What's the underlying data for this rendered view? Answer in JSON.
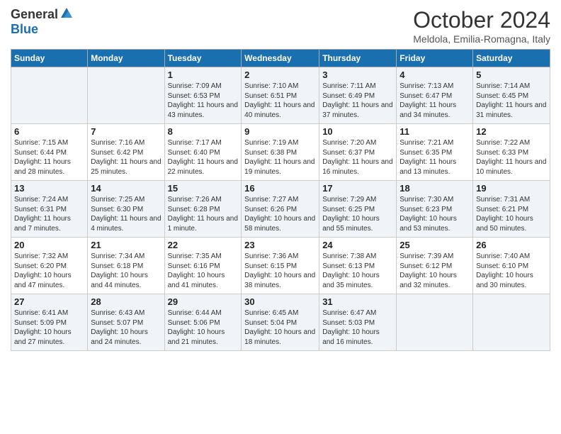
{
  "logo": {
    "general": "General",
    "blue": "Blue"
  },
  "title": "October 2024",
  "location": "Meldola, Emilia-Romagna, Italy",
  "days_of_week": [
    "Sunday",
    "Monday",
    "Tuesday",
    "Wednesday",
    "Thursday",
    "Friday",
    "Saturday"
  ],
  "weeks": [
    [
      {
        "day": "",
        "info": ""
      },
      {
        "day": "",
        "info": ""
      },
      {
        "day": "1",
        "info": "Sunrise: 7:09 AM\nSunset: 6:53 PM\nDaylight: 11 hours and 43 minutes."
      },
      {
        "day": "2",
        "info": "Sunrise: 7:10 AM\nSunset: 6:51 PM\nDaylight: 11 hours and 40 minutes."
      },
      {
        "day": "3",
        "info": "Sunrise: 7:11 AM\nSunset: 6:49 PM\nDaylight: 11 hours and 37 minutes."
      },
      {
        "day": "4",
        "info": "Sunrise: 7:13 AM\nSunset: 6:47 PM\nDaylight: 11 hours and 34 minutes."
      },
      {
        "day": "5",
        "info": "Sunrise: 7:14 AM\nSunset: 6:45 PM\nDaylight: 11 hours and 31 minutes."
      }
    ],
    [
      {
        "day": "6",
        "info": "Sunrise: 7:15 AM\nSunset: 6:44 PM\nDaylight: 11 hours and 28 minutes."
      },
      {
        "day": "7",
        "info": "Sunrise: 7:16 AM\nSunset: 6:42 PM\nDaylight: 11 hours and 25 minutes."
      },
      {
        "day": "8",
        "info": "Sunrise: 7:17 AM\nSunset: 6:40 PM\nDaylight: 11 hours and 22 minutes."
      },
      {
        "day": "9",
        "info": "Sunrise: 7:19 AM\nSunset: 6:38 PM\nDaylight: 11 hours and 19 minutes."
      },
      {
        "day": "10",
        "info": "Sunrise: 7:20 AM\nSunset: 6:37 PM\nDaylight: 11 hours and 16 minutes."
      },
      {
        "day": "11",
        "info": "Sunrise: 7:21 AM\nSunset: 6:35 PM\nDaylight: 11 hours and 13 minutes."
      },
      {
        "day": "12",
        "info": "Sunrise: 7:22 AM\nSunset: 6:33 PM\nDaylight: 11 hours and 10 minutes."
      }
    ],
    [
      {
        "day": "13",
        "info": "Sunrise: 7:24 AM\nSunset: 6:31 PM\nDaylight: 11 hours and 7 minutes."
      },
      {
        "day": "14",
        "info": "Sunrise: 7:25 AM\nSunset: 6:30 PM\nDaylight: 11 hours and 4 minutes."
      },
      {
        "day": "15",
        "info": "Sunrise: 7:26 AM\nSunset: 6:28 PM\nDaylight: 11 hours and 1 minute."
      },
      {
        "day": "16",
        "info": "Sunrise: 7:27 AM\nSunset: 6:26 PM\nDaylight: 10 hours and 58 minutes."
      },
      {
        "day": "17",
        "info": "Sunrise: 7:29 AM\nSunset: 6:25 PM\nDaylight: 10 hours and 55 minutes."
      },
      {
        "day": "18",
        "info": "Sunrise: 7:30 AM\nSunset: 6:23 PM\nDaylight: 10 hours and 53 minutes."
      },
      {
        "day": "19",
        "info": "Sunrise: 7:31 AM\nSunset: 6:21 PM\nDaylight: 10 hours and 50 minutes."
      }
    ],
    [
      {
        "day": "20",
        "info": "Sunrise: 7:32 AM\nSunset: 6:20 PM\nDaylight: 10 hours and 47 minutes."
      },
      {
        "day": "21",
        "info": "Sunrise: 7:34 AM\nSunset: 6:18 PM\nDaylight: 10 hours and 44 minutes."
      },
      {
        "day": "22",
        "info": "Sunrise: 7:35 AM\nSunset: 6:16 PM\nDaylight: 10 hours and 41 minutes."
      },
      {
        "day": "23",
        "info": "Sunrise: 7:36 AM\nSunset: 6:15 PM\nDaylight: 10 hours and 38 minutes."
      },
      {
        "day": "24",
        "info": "Sunrise: 7:38 AM\nSunset: 6:13 PM\nDaylight: 10 hours and 35 minutes."
      },
      {
        "day": "25",
        "info": "Sunrise: 7:39 AM\nSunset: 6:12 PM\nDaylight: 10 hours and 32 minutes."
      },
      {
        "day": "26",
        "info": "Sunrise: 7:40 AM\nSunset: 6:10 PM\nDaylight: 10 hours and 30 minutes."
      }
    ],
    [
      {
        "day": "27",
        "info": "Sunrise: 6:41 AM\nSunset: 5:09 PM\nDaylight: 10 hours and 27 minutes."
      },
      {
        "day": "28",
        "info": "Sunrise: 6:43 AM\nSunset: 5:07 PM\nDaylight: 10 hours and 24 minutes."
      },
      {
        "day": "29",
        "info": "Sunrise: 6:44 AM\nSunset: 5:06 PM\nDaylight: 10 hours and 21 minutes."
      },
      {
        "day": "30",
        "info": "Sunrise: 6:45 AM\nSunset: 5:04 PM\nDaylight: 10 hours and 18 minutes."
      },
      {
        "day": "31",
        "info": "Sunrise: 6:47 AM\nSunset: 5:03 PM\nDaylight: 10 hours and 16 minutes."
      },
      {
        "day": "",
        "info": ""
      },
      {
        "day": "",
        "info": ""
      }
    ]
  ]
}
